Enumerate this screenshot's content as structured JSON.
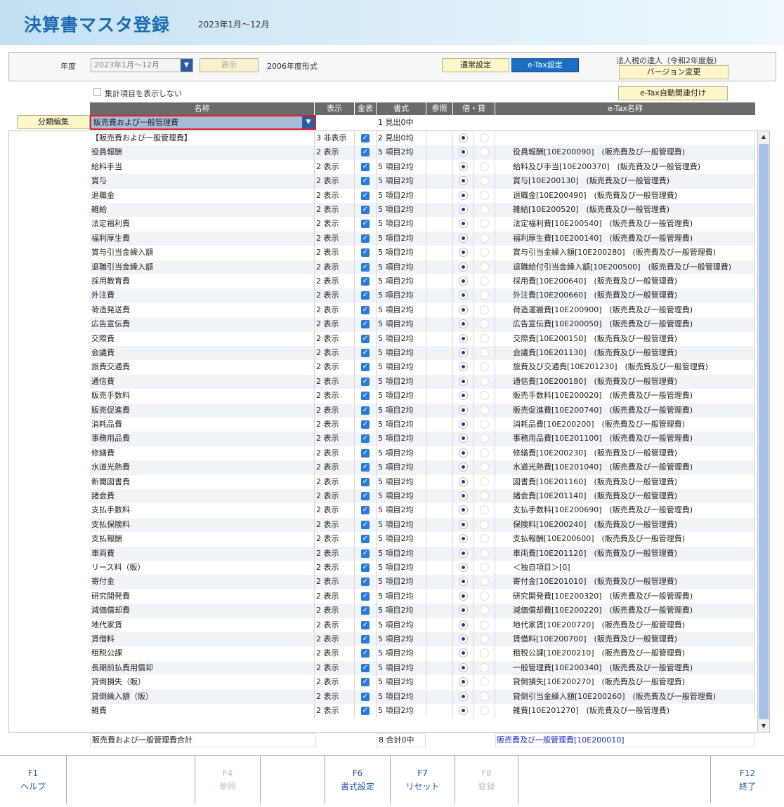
{
  "header": {
    "title": "決算書マスタ登録",
    "period": "2023年1月～12月"
  },
  "settings": {
    "year_label": "年度",
    "year_value": "2023年1月～12月",
    "show_button": "表示",
    "format_label": "2006年度形式",
    "normal_settings_button": "通常設定",
    "etax_settings_button": "e-Tax設定",
    "product_name": "法人税の達人（令和2年度版）",
    "version_change_button": "バージョン変更",
    "etax_auto_link_button": "e-Tax自動関連付け",
    "hide_summary_label": "集計項目を表示しない"
  },
  "columns": {
    "name": "名称",
    "display": "表示",
    "amount": "金表",
    "format": "書式",
    "ref": "参照",
    "debit_credit": "借・貸",
    "etax_name": "e-Tax名称"
  },
  "category": {
    "edit_button": "分類編集",
    "selected": "販売費および一般管理費",
    "header_format": "1 見出0中"
  },
  "group_row": {
    "name": "【販売費および一般管理費】",
    "display": "3 非表示",
    "format": "2 見出0均"
  },
  "rows": [
    {
      "name": "役員報酬",
      "etax": "役員報酬[10E200090]　(販売費及び一般管理費)"
    },
    {
      "name": "給料手当",
      "etax": "給料及び手当[10E200370]　(販売費及び一般管理費)"
    },
    {
      "name": "賞与",
      "etax": "賞与[10E200130]　(販売費及び一般管理費)"
    },
    {
      "name": "退職金",
      "etax": "退職金[10E200490]　(販売費及び一般管理費)"
    },
    {
      "name": "雑給",
      "etax": "雑給[10E200520]　(販売費及び一般管理費)"
    },
    {
      "name": "法定福利費",
      "etax": "法定福利費[10E200540]　(販売費及び一般管理費)"
    },
    {
      "name": "福利厚生費",
      "etax": "福利厚生費[10E200140]　(販売費及び一般管理費)"
    },
    {
      "name": "賞与引当金繰入額",
      "etax": "賞与引当金繰入額[10E200280]　(販売費及び一般管理費)"
    },
    {
      "name": "退職引当金繰入額",
      "etax": "退職給付引当金繰入額[10E200500]　(販売費及び一般管理費)"
    },
    {
      "name": "採用教育費",
      "etax": "採用費[10E200640]　(販売費及び一般管理費)"
    },
    {
      "name": "外注費",
      "etax": "外注費[10E200660]　(販売費及び一般管理費)"
    },
    {
      "name": "荷造発送費",
      "etax": "荷造運搬費[10E200900]　(販売費及び一般管理費)"
    },
    {
      "name": "広告宣伝費",
      "etax": "広告宣伝費[10E200050]　(販売費及び一般管理費)"
    },
    {
      "name": "交際費",
      "etax": "交際費[10E200150]　(販売費及び一般管理費)"
    },
    {
      "name": "会議費",
      "etax": "会議費[10E201130]　(販売費及び一般管理費)"
    },
    {
      "name": "旅費交通費",
      "etax": "旅費及び交通費[10E201230]　(販売費及び一般管理費)"
    },
    {
      "name": "通信費",
      "etax": "通信費[10E200180]　(販売費及び一般管理費)"
    },
    {
      "name": "販売手数料",
      "etax": "販売手数料[10E200020]　(販売費及び一般管理費)"
    },
    {
      "name": "販売促進費",
      "etax": "販売促進費[10E200740]　(販売費及び一般管理費)"
    },
    {
      "name": "消耗品費",
      "etax": "消耗品費[10E200200]　(販売費及び一般管理費)"
    },
    {
      "name": "事務用品費",
      "etax": "事務用品費[10E201100]　(販売費及び一般管理費)"
    },
    {
      "name": "修繕費",
      "etax": "修繕費[10E200230]　(販売費及び一般管理費)"
    },
    {
      "name": "水道光熱費",
      "etax": "水道光熱費[10E201040]　(販売費及び一般管理費)"
    },
    {
      "name": "新聞図書費",
      "etax": "図書費[10E201160]　(販売費及び一般管理費)"
    },
    {
      "name": "諸会費",
      "etax": "諸会費[10E201140]　(販売費及び一般管理費)"
    },
    {
      "name": "支払手数料",
      "etax": "支払手数料[10E200690]　(販売費及び一般管理費)"
    },
    {
      "name": "支払保険料",
      "etax": "保険料[10E200240]　(販売費及び一般管理費)"
    },
    {
      "name": "支払報酬",
      "etax": "支払報酬[10E200600]　(販売費及び一般管理費)"
    },
    {
      "name": "車両費",
      "etax": "車両費[10E201120]　(販売費及び一般管理費)"
    },
    {
      "name": "リース料（販）",
      "etax": "＜独自項目＞[0]"
    },
    {
      "name": "寄付金",
      "etax": "寄付金[10E201010]　(販売費及び一般管理費)"
    },
    {
      "name": "研究開発費",
      "etax": "研究開発費[10E200320]　(販売費及び一般管理費)"
    },
    {
      "name": "減価償却費",
      "etax": "減価償却費[10E200220]　(販売費及び一般管理費)"
    },
    {
      "name": "地代家賃",
      "etax": "地代家賃[10E200720]　(販売費及び一般管理費)"
    },
    {
      "name": "賃借料",
      "etax": "賃借料[10E200700]　(販売費及び一般管理費)"
    },
    {
      "name": "租税公課",
      "etax": "租税公課[10E200210]　(販売費及び一般管理費)"
    },
    {
      "name": "長期前払費用償却",
      "etax": "一般管理費[10E200340]　(販売費及び一般管理費)"
    },
    {
      "name": "貸倒損失（販）",
      "etax": "貸倒損失[10E200270]　(販売費及び一般管理費)"
    },
    {
      "name": "貸倒繰入額（販）",
      "etax": "貸倒引当金繰入額[10E200260]　(販売費及び一般管理費)"
    },
    {
      "name": "雑費",
      "etax": "雑費[10E201270]　(販売費及び一般管理費)"
    }
  ],
  "row_defaults": {
    "display": "2 表示",
    "format": "5 項目2均"
  },
  "total_row": {
    "name": "販売費および一般管理費合計",
    "format": "8 合計0中",
    "etax": "販売費及び一般管理費[10E200010]"
  },
  "fkeys": [
    {
      "key": "F1",
      "label": "ヘルプ",
      "enabled": true
    },
    {
      "key": "F4",
      "label": "参照",
      "enabled": false
    },
    {
      "key": "F6",
      "label": "書式設定",
      "enabled": true
    },
    {
      "key": "F7",
      "label": "リセット",
      "enabled": true
    },
    {
      "key": "F8",
      "label": "登録",
      "enabled": false
    },
    {
      "key": "F12",
      "label": "終了",
      "enabled": true
    }
  ]
}
